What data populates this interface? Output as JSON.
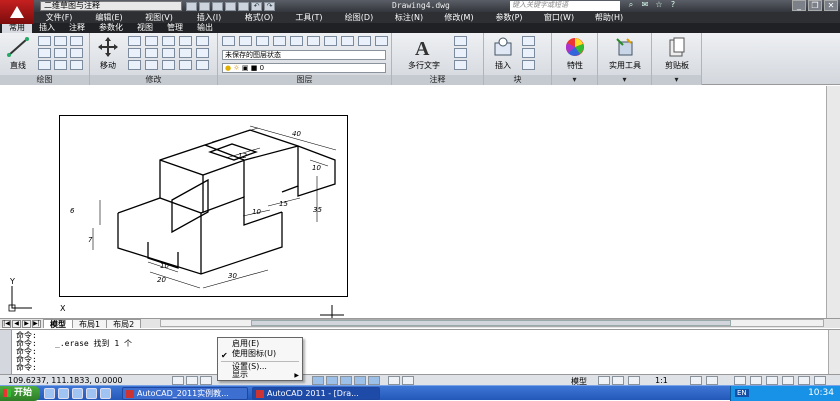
{
  "titlebar": {
    "workspace": "二维草图与注释",
    "document": "Drawing4.dwg",
    "search_placeholder": "键入关键字或短语"
  },
  "menubar": {
    "items": [
      "文件(F)",
      "编辑(E)",
      "视图(V)",
      "插入(I)",
      "格式(O)",
      "工具(T)",
      "绘图(D)",
      "标注(N)",
      "修改(M)",
      "参数(P)",
      "窗口(W)",
      "帮助(H)"
    ]
  },
  "ribbon_tabs": [
    "常用",
    "插入",
    "注释",
    "参数化",
    "视图",
    "管理",
    "输出"
  ],
  "ribbon": {
    "panels": {
      "draw": {
        "title": "绘图",
        "line_label": "直线"
      },
      "modify": {
        "title": "修改",
        "move_label": "移动"
      },
      "layers": {
        "title": "图层",
        "layer_state": "未保存的图层状态",
        "current_layer": "0"
      },
      "annotation": {
        "title": "注释",
        "mtext_label": "多行文字"
      },
      "block": {
        "title": "块",
        "insert_label": "插入"
      },
      "properties": {
        "label": "特性"
      },
      "utilities": {
        "label": "实用工具"
      },
      "clipboard": {
        "label": "剪贴板"
      }
    }
  },
  "drawing": {
    "dimensions": [
      "40",
      "12",
      "10",
      "35",
      "15",
      "10",
      "6",
      "7",
      "10",
      "20",
      "30"
    ],
    "ucs": {
      "x_label": "X",
      "y_label": "Y"
    }
  },
  "layout_tabs": [
    "模型",
    "布局1",
    "布局2"
  ],
  "command": {
    "lines": [
      "命令:",
      "命令:",
      "命令:",
      "命令:",
      "命令:"
    ],
    "erase_text": "_.erase 找到 1 个"
  },
  "context_menu": {
    "items": [
      "启用(E)",
      "使用图标(U)",
      "设置(S)...",
      "显示"
    ],
    "checked_index": 1
  },
  "statusbar": {
    "coords": "109.6237, 111.1833, 0.0000",
    "model_label": "模型",
    "scale": "1:1"
  },
  "taskbar": {
    "start_label": "开始",
    "tasks": [
      "AutoCAD_2011实例教...",
      "AutoCAD 2011 - [Dra..."
    ],
    "lang": "EN",
    "time": "10:34"
  }
}
